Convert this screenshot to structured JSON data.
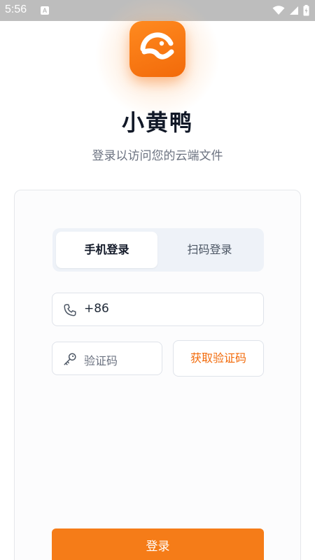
{
  "status_bar": {
    "time": "5:56",
    "notification_badge": "A"
  },
  "app": {
    "name": "小黄鸭",
    "subtitle": "登录以访问您的云端文件"
  },
  "login": {
    "tabs": [
      {
        "label": "手机登录",
        "active": true
      },
      {
        "label": "扫码登录",
        "active": false
      }
    ],
    "phone": {
      "value": "+86"
    },
    "code": {
      "placeholder": "验证码"
    },
    "get_code_label": "获取验证码",
    "submit_label": "登录"
  },
  "colors": {
    "accent": "#f26a0a",
    "status_bar": "#bdbdbd"
  }
}
